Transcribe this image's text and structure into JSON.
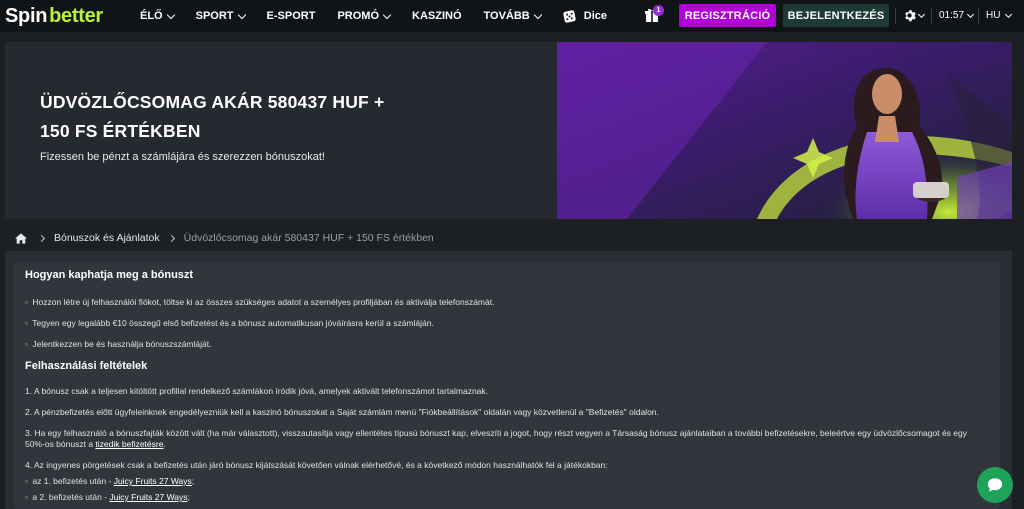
{
  "logo": {
    "spin": "Spin",
    "better": "better"
  },
  "nav": [
    {
      "label": "ÉLŐ",
      "dropdown": true
    },
    {
      "label": "SPORT",
      "dropdown": true
    },
    {
      "label": "E-SPORT",
      "dropdown": false
    },
    {
      "label": "PROMÓ",
      "dropdown": true
    },
    {
      "label": "KASZINÓ",
      "dropdown": false
    },
    {
      "label": "TOVÁBB",
      "dropdown": true
    }
  ],
  "dice": {
    "label": "Dice"
  },
  "header": {
    "gift_badge": "1",
    "register_label": "REGISZTRÁCIÓ",
    "login_label": "BEJELENTKEZÉS",
    "time": "01:57",
    "language": "HU"
  },
  "banner": {
    "title": "ÜDVÖZLŐCSOMAG AKÁR 580437 HUF + 150 FS ÉRTÉKBEN",
    "subtitle": "Fizessen be pénzt a számlájára és szerezzen bónuszokat!"
  },
  "breadcrumb": {
    "link": "Bónuszok és Ajánlatok",
    "current": "Üdvözlőcsomag akár 580437 HUF + 150 FS értékben"
  },
  "content": {
    "how_title": "Hogyan kaphatja meg a bónuszt",
    "how_steps": [
      "Hozzon létre új felhasználói fiókot, töltse ki az összes szükséges adatot a személyes profiljában és aktiválja telefonszámát.",
      "Tegyen egy legalább €10 összegű első befizetést és a bónusz automatikusan jóváírásra kerül a számláján.",
      "Jelentkezzen be és használja bónuszszámláját."
    ],
    "terms_title": "Felhasználási feltételek",
    "term1": "1. A bónusz csak a teljesen kitöltött profillal rendelkező számlákon íródik jóvá, amelyek aktivált telefonszámot tartalmaznak.",
    "term2": "2. A pénzbefizetés előtt ügyfeleinknek engedélyezniük kell a kaszinó bónuszokat a Saját számlám menü \"Fiókbeállítások\" oldalán vagy közvetlenül a \"Befizetés\" oldalon.",
    "term3_text": "3. Ha egy felhasználó a bónuszfajták között vált (ha már választott), visszautasítja vagy ellentétes típusú bónuszt kap, elveszíti a jogot, hogy részt vegyen a Társaság bónusz ajánlataiban a további befizetésekre, beleértve egy üdvözlőcsomagot és egy 50%-os bónuszt a",
    "term3_link": "tizedik befizetésre",
    "term3_end": ".",
    "term4": "4. Az ingyenes pörgetések csak a befizetés után járó bónusz kijátszását követően válnak elérhetővé, és a következő módon használhatók fel a játékokban:",
    "spins": [
      {
        "prefix": "az 1. befizetés után -",
        "game": "Juicy Fruits 27 Ways",
        "suffix": ";"
      },
      {
        "prefix": "a 2. befizetés után -",
        "game": "Juicy Fruits 27 Ways",
        "suffix": ";"
      }
    ]
  },
  "colors": {
    "accent_green": "#b8f23c",
    "register_purple": "#b200d6",
    "chat_green": "#1fa25a"
  }
}
